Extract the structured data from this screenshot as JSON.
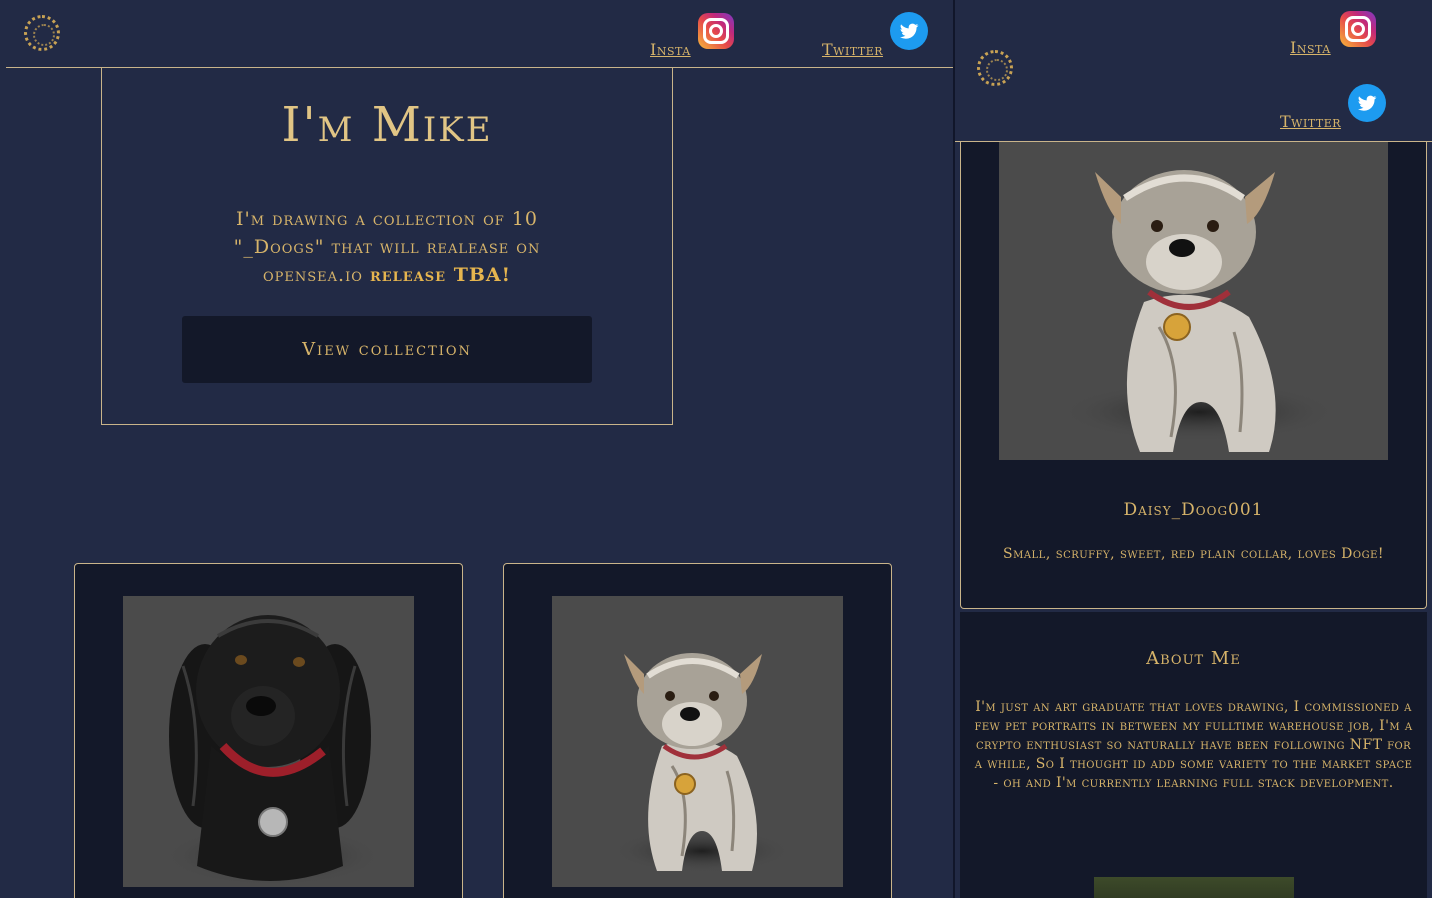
{
  "desktop": {
    "nav": {
      "insta_label": "Insta",
      "twitter_label": "Twitter"
    },
    "hero": {
      "title": "I'm Mike",
      "text_main": "I'm drawing a collection of 10 \"_Doogs\" that will realease on opensea.io ",
      "text_highlight": "release TBA!",
      "button_label": "View collection"
    }
  },
  "mobile": {
    "nav": {
      "insta_label": "Insta",
      "twitter_label": "Twitter"
    },
    "featured_card": {
      "title": "Daisy_Doog001",
      "description": "Small, scruffy, sweet, red plain collar, loves Doge!"
    },
    "about": {
      "heading": "About Me",
      "text": "I'm just an art graduate that loves drawing, I commissioned a few pet portraits in between my fulltime warehouse job, I'm a crypto enthusiast so naturally have been following NFT for a while, So I thought id add some variety to the market space - oh and I'm currently learning full stack development."
    }
  },
  "icons": {
    "logo": "dotted-circle-logo-icon",
    "instagram": "instagram-icon",
    "twitter": "twitter-bird-icon"
  },
  "colors": {
    "background": "#222a45",
    "card_background": "#131829",
    "gold_text": "#d7b46a",
    "border": "#c9b48a",
    "artwork_background": "#4b4b4b"
  }
}
